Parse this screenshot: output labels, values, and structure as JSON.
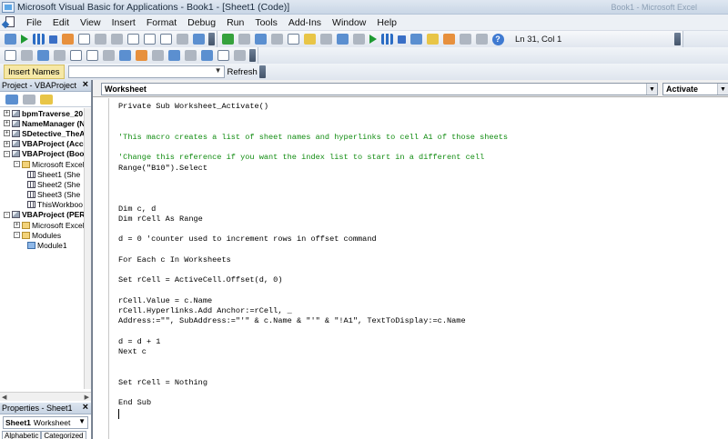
{
  "window": {
    "title": "Microsoft Visual Basic for Applications - Book1 - [Sheet1 (Code)]",
    "ghost_title": "Book1 - Microsoft Excel"
  },
  "menubar": {
    "items": [
      "File",
      "Edit",
      "View",
      "Insert",
      "Format",
      "Debug",
      "Run",
      "Tools",
      "Add-Ins",
      "Window",
      "Help"
    ]
  },
  "toolbar": {
    "position_label": "Ln 31, Col 1",
    "insert_names_label": "Insert Names",
    "names_value": "",
    "refresh_label": "Refresh"
  },
  "project": {
    "title": "Project - VBAProject",
    "tree": [
      {
        "label": "bpmTraverse_20",
        "level": 0,
        "expander": "+",
        "icon": "project",
        "bold": true
      },
      {
        "label": "NameManager (N",
        "level": 0,
        "expander": "+",
        "icon": "project",
        "bold": true
      },
      {
        "label": "SDetective_TheA",
        "level": 0,
        "expander": "+",
        "icon": "project",
        "bold": true
      },
      {
        "label": "VBAProject (Acce",
        "level": 0,
        "expander": "+",
        "icon": "project",
        "bold": true
      },
      {
        "label": "VBAProject (Book",
        "level": 0,
        "expander": "-",
        "icon": "project",
        "bold": true
      },
      {
        "label": "Microsoft Excel O",
        "level": 1,
        "expander": "-",
        "icon": "folder",
        "bold": false
      },
      {
        "label": "Sheet1 (She",
        "level": 2,
        "expander": "",
        "icon": "sheet",
        "bold": false
      },
      {
        "label": "Sheet2 (She",
        "level": 2,
        "expander": "",
        "icon": "sheet",
        "bold": false
      },
      {
        "label": "Sheet3 (She",
        "level": 2,
        "expander": "",
        "icon": "sheet",
        "bold": false
      },
      {
        "label": "ThisWorkboo",
        "level": 2,
        "expander": "",
        "icon": "sheet",
        "bold": false
      },
      {
        "label": "VBAProject (PERS",
        "level": 0,
        "expander": "-",
        "icon": "project",
        "bold": true
      },
      {
        "label": "Microsoft Excel O",
        "level": 1,
        "expander": "+",
        "icon": "folder",
        "bold": false
      },
      {
        "label": "Modules",
        "level": 1,
        "expander": "-",
        "icon": "folder",
        "bold": false
      },
      {
        "label": "Module1",
        "level": 2,
        "expander": "",
        "icon": "module",
        "bold": false
      }
    ]
  },
  "properties": {
    "title": "Properties - Sheet1",
    "object_name": "Sheet1",
    "object_type": "Worksheet",
    "tabs": [
      "Alphabetic",
      "Categorized"
    ]
  },
  "code_window": {
    "object": "Worksheet",
    "procedure": "Activate",
    "lines": [
      {
        "text": "Private Sub Worksheet_Activate()",
        "comment": false,
        "row": 0
      },
      {
        "text": "'This macro creates a list of sheet names and hyperlinks to cell A1 of those sheets",
        "comment": true,
        "row": 3
      },
      {
        "text": "'Change this reference if you want the index list to start in a different cell",
        "comment": true,
        "row": 5
      },
      {
        "text": "Range(\"B10\").Select",
        "comment": false,
        "row": 6
      },
      {
        "text": "Dim c, d",
        "comment": false,
        "row": 10
      },
      {
        "text": "Dim rCell As Range",
        "comment": false,
        "row": 11
      },
      {
        "text": "d = 0 'counter used to increment rows in offset command",
        "comment": false,
        "row": 13
      },
      {
        "text": "For Each c In Worksheets",
        "comment": false,
        "row": 15
      },
      {
        "text": "Set rCell = ActiveCell.Offset(d, 0)",
        "comment": false,
        "row": 17
      },
      {
        "text": "rCell.Value = c.Name",
        "comment": false,
        "row": 19
      },
      {
        "text": "rCell.Hyperlinks.Add Anchor:=rCell, _",
        "comment": false,
        "row": 20
      },
      {
        "text": "Address:=\"\", SubAddress:=\"'\" & c.Name & \"'\" & \"!A1\", TextToDisplay:=c.Name",
        "comment": false,
        "row": 21
      },
      {
        "text": "d = d + 1",
        "comment": false,
        "row": 23
      },
      {
        "text": "Next c",
        "comment": false,
        "row": 24
      },
      {
        "text": "Set rCell = Nothing",
        "comment": false,
        "row": 27
      },
      {
        "text": "End Sub",
        "comment": false,
        "row": 29
      }
    ],
    "caret_row": 30
  }
}
